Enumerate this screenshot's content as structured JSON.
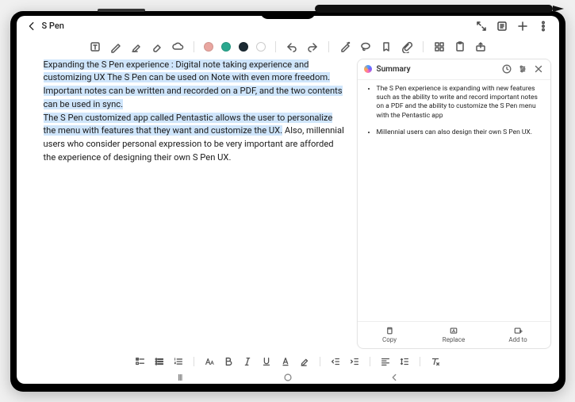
{
  "header": {
    "title": "S Pen"
  },
  "colors": {
    "swatch1": "#e9a6a0",
    "swatch2": "#2aa88f",
    "swatch3": "#1b2a33",
    "swatch4": "#ffffff"
  },
  "note": {
    "p1_hl": "Expanding the S Pen experience : Digital note taking experience and customizing UX The S Pen can be used on Note with even more freedom. Important notes can be written and recorded on a PDF, and the two contents can be used in sync.",
    "p2_hl": "The S Pen customized app called Pentastic allows the user to personalize the menu with features that they want and customize the UX.",
    "p2_rest": " Also, millennial users who consider personal expression to be very important are afforded the experience of designing their own S Pen UX."
  },
  "summary": {
    "title": "Summary",
    "bullets": [
      "The S Pen experience is expanding with new features such as the ability to write and record important notes on a PDF and the ability to customize the S Pen menu with the Pentastic app",
      "Millennial users can also design their own S Pen UX."
    ],
    "actions": {
      "copy": "Copy",
      "replace": "Replace",
      "addto": "Add to"
    }
  }
}
